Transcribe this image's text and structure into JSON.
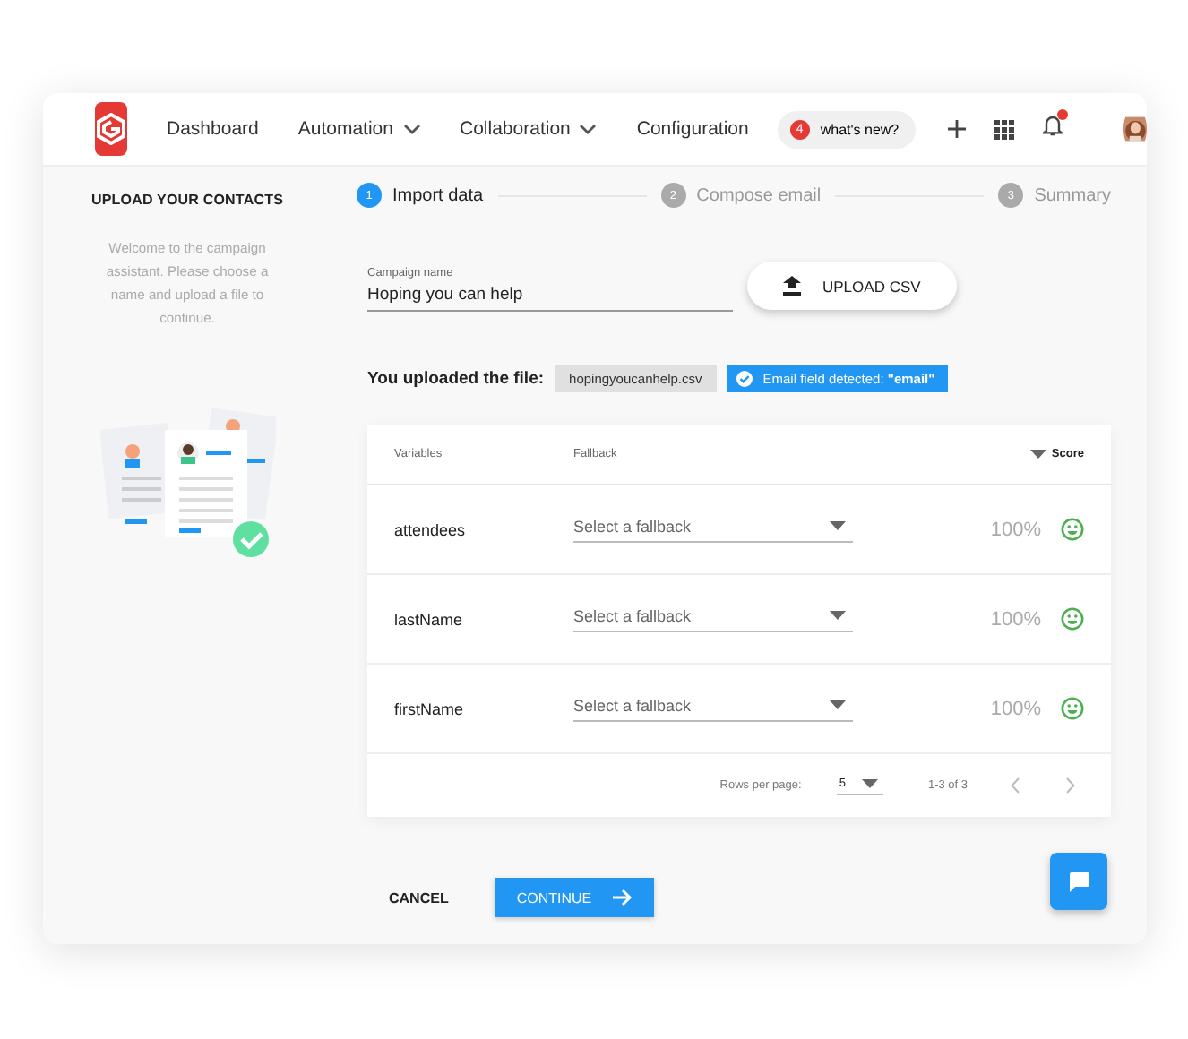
{
  "nav": {
    "items": [
      {
        "label": "Dashboard",
        "dropdown": false
      },
      {
        "label": "Automation",
        "dropdown": true
      },
      {
        "label": "Collaboration",
        "dropdown": true
      },
      {
        "label": "Configuration",
        "dropdown": false
      }
    ],
    "news": {
      "count": "4",
      "label": "what's new?"
    },
    "notification": true
  },
  "sidebar": {
    "title": "UPLOAD YOUR CONTACTS",
    "text": "Welcome to the campaign assistant. Please choose a name and upload a file to continue."
  },
  "steps": [
    {
      "number": "1",
      "label": "Import data",
      "selected": true
    },
    {
      "number": "2",
      "label": "Compose email",
      "selected": false
    },
    {
      "number": "3",
      "label": "Summary",
      "selected": false
    }
  ],
  "campaign_name": {
    "label": "Campaign name",
    "value": "Hoping you can help"
  },
  "upload_button": "UPLOAD CSV",
  "uploaded": {
    "label": "You uploaded the file:",
    "file": "hopingyoucanhelp.csv",
    "detected_prefix": "Email field detected: ",
    "detected_value": "\"email\""
  },
  "table": {
    "columns": [
      "Variables",
      "Fallback",
      "Score"
    ],
    "rows": [
      {
        "variable": "attendees",
        "fallback_placeholder": "Select a fallback",
        "score": "100%"
      },
      {
        "variable": "lastName",
        "fallback_placeholder": "Select a fallback",
        "score": "100%"
      },
      {
        "variable": "firstName",
        "fallback_placeholder": "Select a fallback",
        "score": "100%"
      }
    ],
    "footer": {
      "rows_label": "Rows per page:",
      "rows_value": "5",
      "range": "1-3 of 3"
    }
  },
  "buttons": {
    "cancel": "CANCEL",
    "continue": "CONTINUE"
  }
}
